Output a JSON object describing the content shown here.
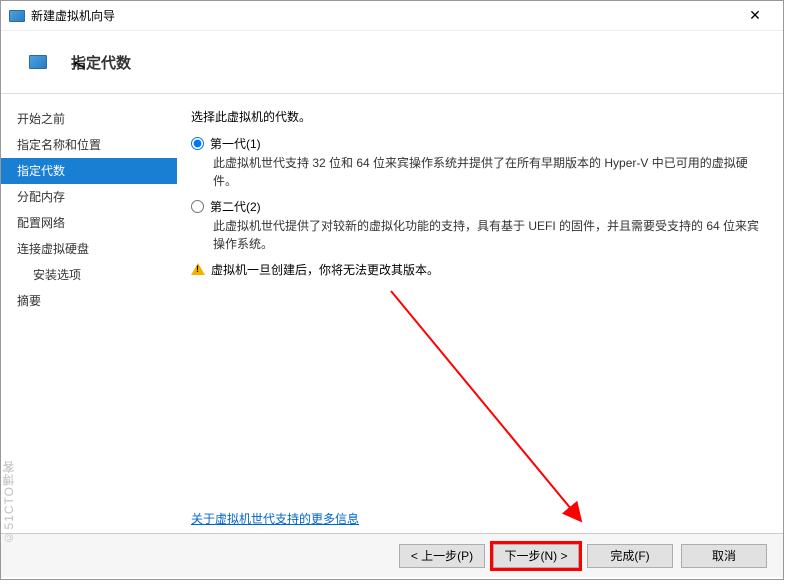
{
  "window": {
    "title": "新建虚拟机向导"
  },
  "header": {
    "title": "指定代数"
  },
  "sidebar": {
    "items": [
      {
        "label": "开始之前"
      },
      {
        "label": "指定名称和位置"
      },
      {
        "label": "指定代数"
      },
      {
        "label": "分配内存"
      },
      {
        "label": "配置网络"
      },
      {
        "label": "连接虚拟硬盘"
      },
      {
        "label": "安装选项"
      },
      {
        "label": "摘要"
      }
    ]
  },
  "main": {
    "prompt": "选择此虚拟机的代数。",
    "gen1": {
      "label": "第一代(1)",
      "desc": "此虚拟机世代支持 32 位和 64 位来宾操作系统并提供了在所有早期版本的 Hyper-V 中已可用的虚拟硬件。"
    },
    "gen2": {
      "label": "第二代(2)",
      "desc": "此虚拟机世代提供了对较新的虚拟化功能的支持，具有基于 UEFI 的固件，并且需要受支持的 64 位来宾操作系统。"
    },
    "warning": "虚拟机一旦创建后，你将无法更改其版本。",
    "link": "关于虚拟机世代支持的更多信息"
  },
  "footer": {
    "prev": "< 上一步(P)",
    "next": "下一步(N) >",
    "finish": "完成(F)",
    "cancel": "取消"
  },
  "watermark": "©51CTO博客"
}
